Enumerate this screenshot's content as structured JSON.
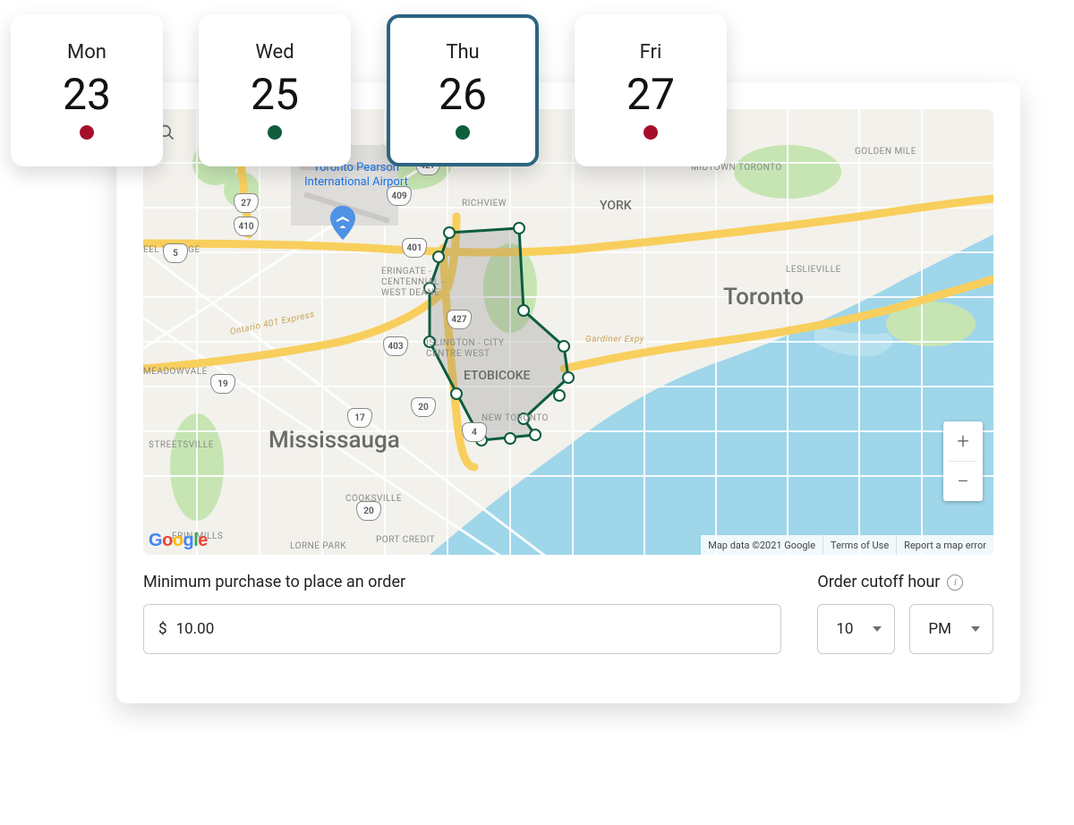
{
  "dates": [
    {
      "day": "Mon",
      "num": "23",
      "status": "red"
    },
    {
      "day": "Wed",
      "num": "25",
      "status": "green"
    },
    {
      "day": "Thu",
      "num": "26",
      "status": "green",
      "selected": true
    },
    {
      "day": "Fri",
      "num": "27",
      "status": "red"
    }
  ],
  "map": {
    "attribution": "Map data ©2021 Google",
    "terms": "Terms of Use",
    "report": "Report a map error",
    "logo_letters": [
      "G",
      "o",
      "o",
      "g",
      "l",
      "e"
    ],
    "labels": {
      "toronto": "Toronto",
      "mississauga": "Mississauga",
      "etobicoke": "ETOBICOKE",
      "midtown": "MIDTOWN TORONTO",
      "goldenmile": "GOLDEN MILE",
      "leslieville": "LESLIEVILLE",
      "york": "YORK",
      "richview": "RICHVIEW",
      "newtoronto": "NEW TORONTO",
      "cooksville": "COOKSVILLE",
      "portcredit": "PORT CREDIT",
      "lornepark": "LORNE PARK",
      "erinmills": "ERIN MILLS",
      "streetsville": "STREETSVILLE",
      "meadowvale": "MEADOWVALE",
      "eelvillage": "EEL VILLAGE",
      "eringate": "ERINGATE - CENTENNIAL - WEST DEANE",
      "islington": "ISLINGTON - CITY CENTRE WEST",
      "airport": "Toronto Pearson International Airport",
      "gardiner": "Gardiner Expy",
      "ontario401": "Ontario 401 Express"
    },
    "shields": {
      "s401": "401",
      "s409": "409",
      "s410": "410",
      "s427a": "427",
      "s427b": "427",
      "s403": "403",
      "s4": "4",
      "s17": "17",
      "s20a": "20",
      "s20b": "20",
      "s19": "19",
      "s27": "27",
      "s5": "5"
    },
    "zoom_in": "+",
    "zoom_out": "−"
  },
  "form": {
    "min_label": "Minimum purchase to place an order",
    "min_prefix": "$",
    "min_value": "10.00",
    "cutoff_label": "Order cutoff hour",
    "hour": "10",
    "ampm": "PM"
  }
}
